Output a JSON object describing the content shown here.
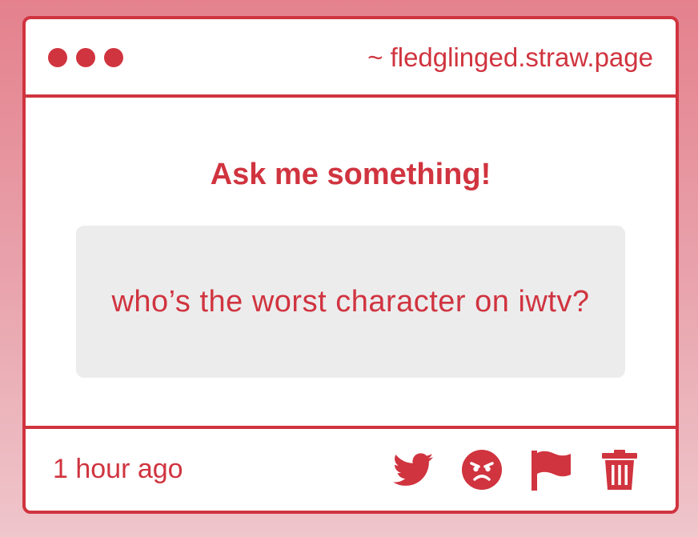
{
  "colors": {
    "accent": "#d0343f",
    "panel": "#ffffff",
    "question_bg": "#ececed"
  },
  "window": {
    "url": "~ fledglinged.straw.page"
  },
  "content": {
    "heading": "Ask me something!",
    "question": "who’s the worst character on iwtv?"
  },
  "footer": {
    "timestamp": "1 hour ago",
    "actions": [
      {
        "icon": "twitter-icon"
      },
      {
        "icon": "angry-face-icon"
      },
      {
        "icon": "flag-icon"
      },
      {
        "icon": "trash-icon"
      }
    ]
  }
}
